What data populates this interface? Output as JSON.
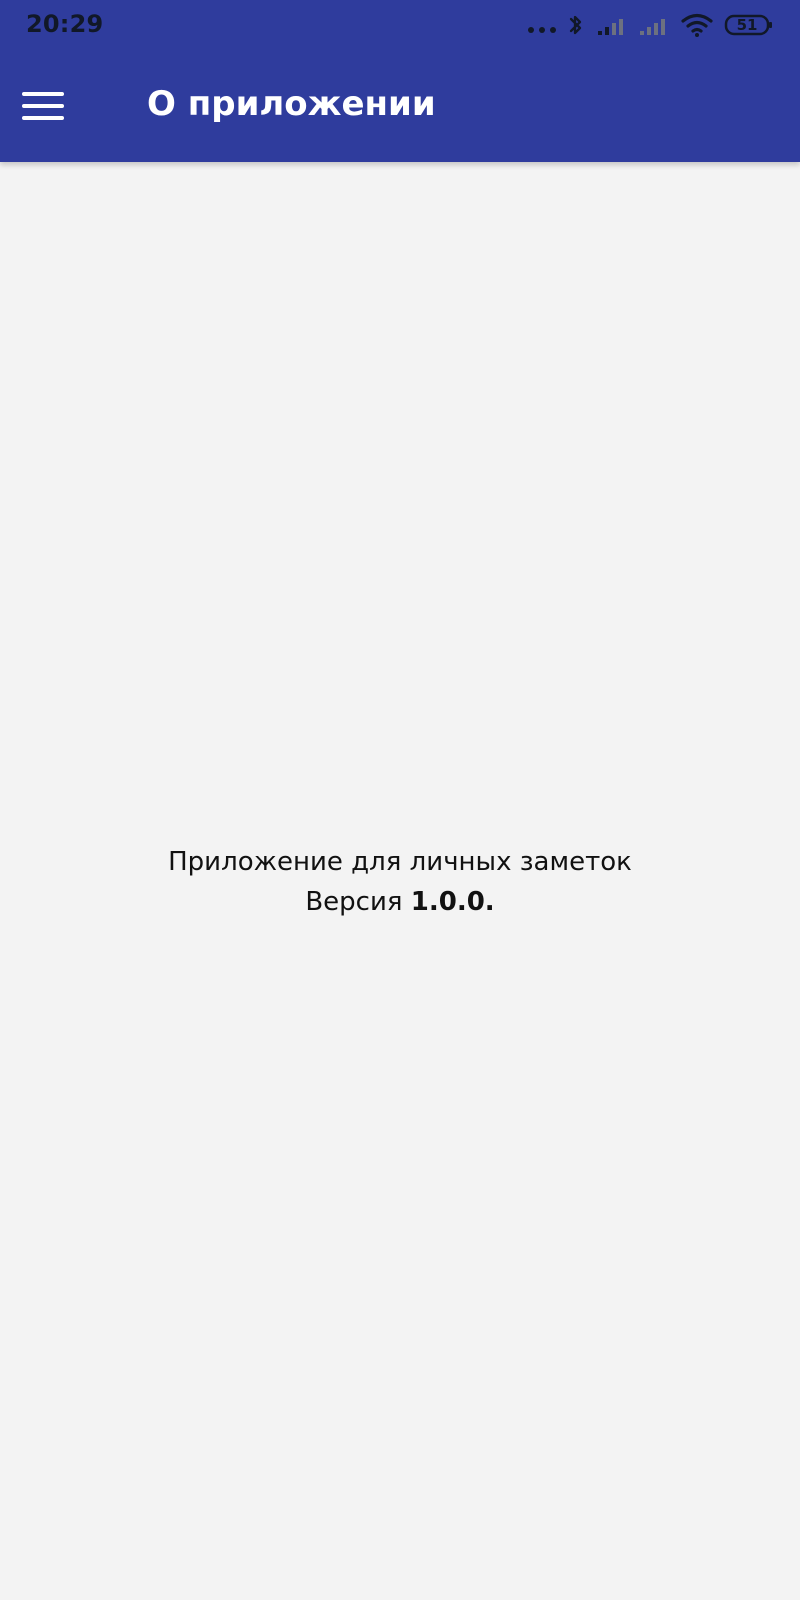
{
  "status_bar": {
    "time": "20:29",
    "battery": "51",
    "icons": [
      "more-dots-icon",
      "bluetooth-icon",
      "cellular-signal-icon",
      "cellular-signal-icon",
      "wifi-icon",
      "battery-icon"
    ]
  },
  "app_bar": {
    "title": "О приложении",
    "menu_icon": "hamburger-menu-icon",
    "background_color": "#2f3c9d"
  },
  "content": {
    "description": "Приложение для личных заметок",
    "version_label": "Версия ",
    "version_number": "1.0.0."
  },
  "colors": {
    "background": "#f3f3f3",
    "text": "#111111",
    "appbar_text": "#ffffff"
  }
}
